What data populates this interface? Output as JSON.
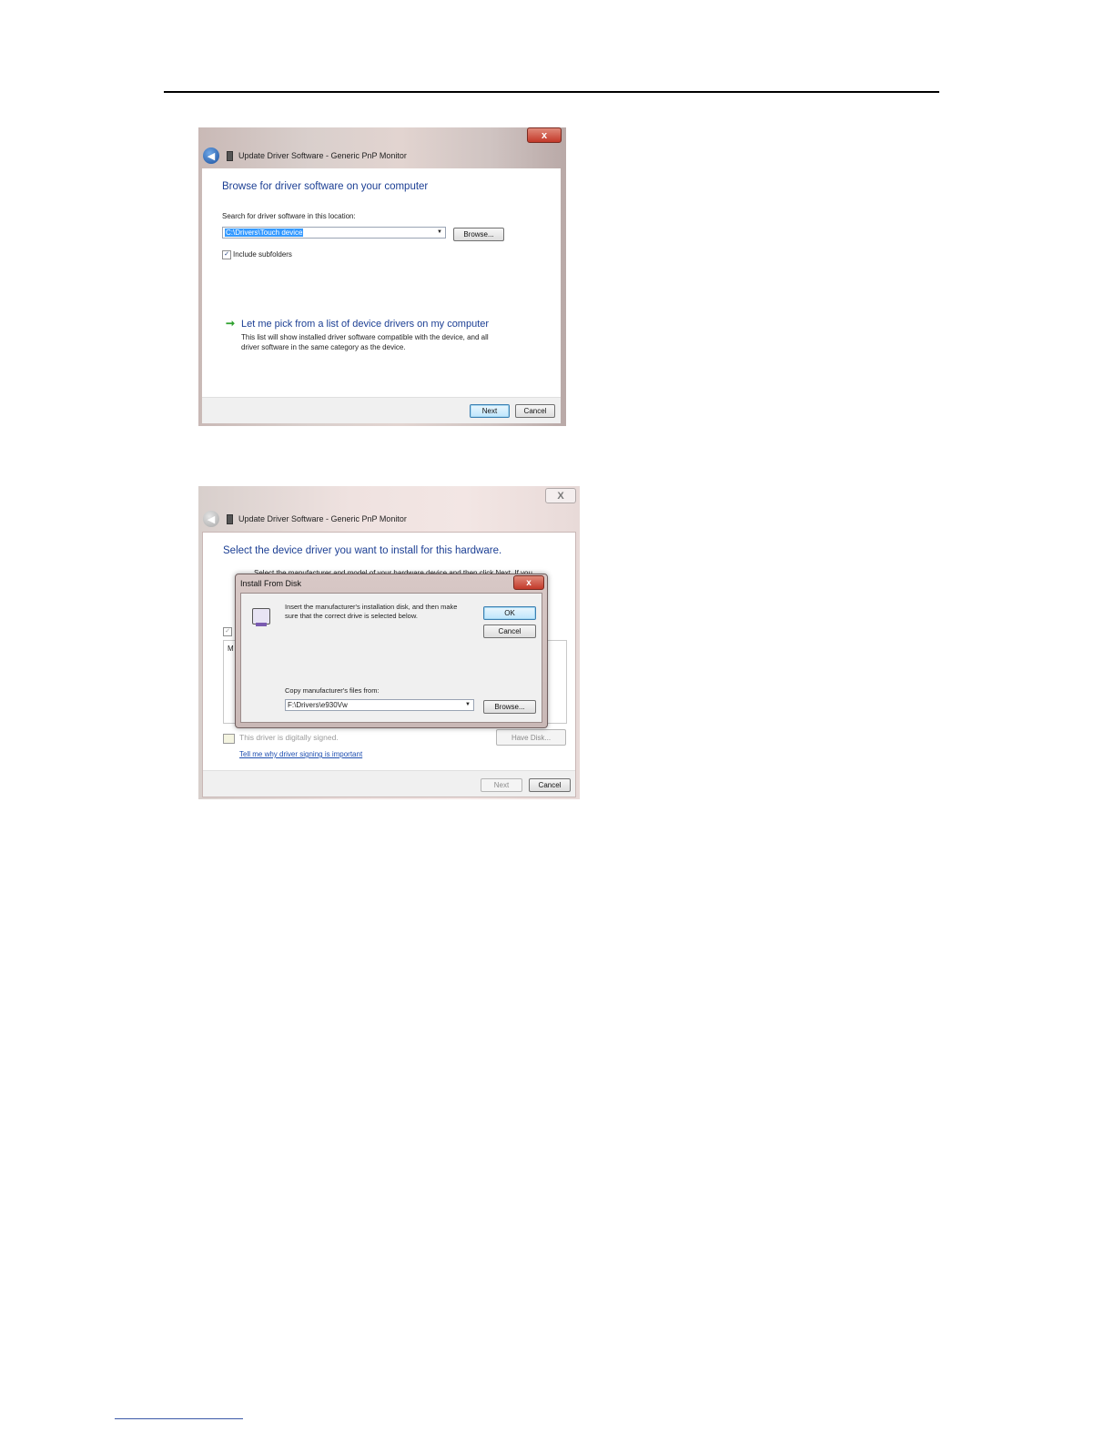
{
  "screenshot1": {
    "close_glyph": "x",
    "window_title": "Update Driver Software - Generic PnP Monitor",
    "heading": "Browse for driver software on your computer",
    "search_label": "Search for driver software in this location:",
    "path_value": "C:\\Drivers\\Touch device",
    "browse_label": "Browse...",
    "include_subfolders_label": "Include subfolders",
    "include_subfolders_checked": true,
    "pick_title": "Let me pick from a list of device drivers on my computer",
    "pick_desc_line1": "This list will show installed driver software compatible with the device, and all",
    "pick_desc_line2": "driver software in the same category as the device.",
    "next_label": "Next",
    "cancel_label": "Cancel"
  },
  "screenshot2": {
    "close_glyph": "X",
    "window_title": "Update Driver Software - Generic PnP Monitor",
    "heading": "Select the device driver you want to install for this hardware.",
    "instruction_partial": "Select the manufacturer and model of your hardware device and then click Next. If you",
    "list_header_partial": "M",
    "signed_text": "This driver is digitally signed.",
    "signing_link": "Tell me why driver signing is important",
    "have_disk_label": "Have Disk...",
    "next_label": "Next",
    "cancel_label": "Cancel",
    "dialog": {
      "title": "Install From Disk",
      "close_glyph": "x",
      "message_line1": "Insert the manufacturer's installation disk, and then make",
      "message_line2": "sure that the correct drive is selected below.",
      "ok_label": "OK",
      "cancel_label": "Cancel",
      "copy_label": "Copy manufacturer's files from:",
      "path_value": "F:\\Drivers\\e930Vw",
      "browse_label": "Browse..."
    }
  }
}
